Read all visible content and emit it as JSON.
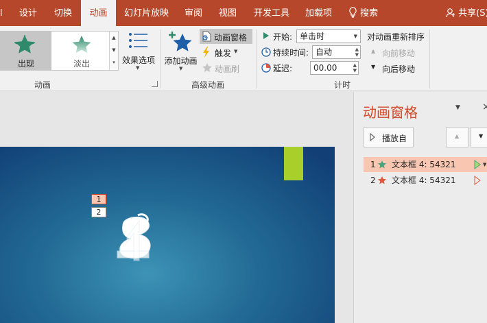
{
  "tabs": [
    {
      "label": "设计"
    },
    {
      "label": "切换"
    },
    {
      "label": "动画"
    },
    {
      "label": "幻灯片放映"
    },
    {
      "label": "审阅"
    },
    {
      "label": "视图"
    },
    {
      "label": "开发工具"
    },
    {
      "label": "加载项"
    }
  ],
  "search": {
    "label": "搜索"
  },
  "share": {
    "label": "共享(S)"
  },
  "ribbon": {
    "gallery": {
      "appear": "出现",
      "fade": "淡出"
    },
    "effect_options": "效果选项",
    "group_animation": "动画",
    "add_animation": "添加动画",
    "anim_pane": "动画窗格",
    "trigger": "触发",
    "anim_painter": "动画刷",
    "group_advanced": "高级动画",
    "start_label": "开始:",
    "start_value": "单击时",
    "duration_label": "持续时间:",
    "duration_value": "自动",
    "delay_label": "延迟:",
    "delay_value": "00.00",
    "group_timing": "计时",
    "reorder_title": "对动画重新排序",
    "move_earlier": "向前移动",
    "move_later": "向后移动"
  },
  "pane": {
    "title": "动画窗格",
    "play_button": "播放自",
    "items": [
      {
        "num": "1",
        "label": "文本框 4: 54321"
      },
      {
        "num": "2",
        "label": "文本框 4: 54321"
      }
    ]
  },
  "slide": {
    "tags": [
      "1",
      "2"
    ]
  },
  "colors": {
    "accent": "#b7472a",
    "pane_title": "#d24726",
    "selected_row": "#f9c6b2",
    "green_star": "#4aa57e",
    "orange_star": "#e0593b",
    "slide_bar": "#a8cf2a"
  }
}
